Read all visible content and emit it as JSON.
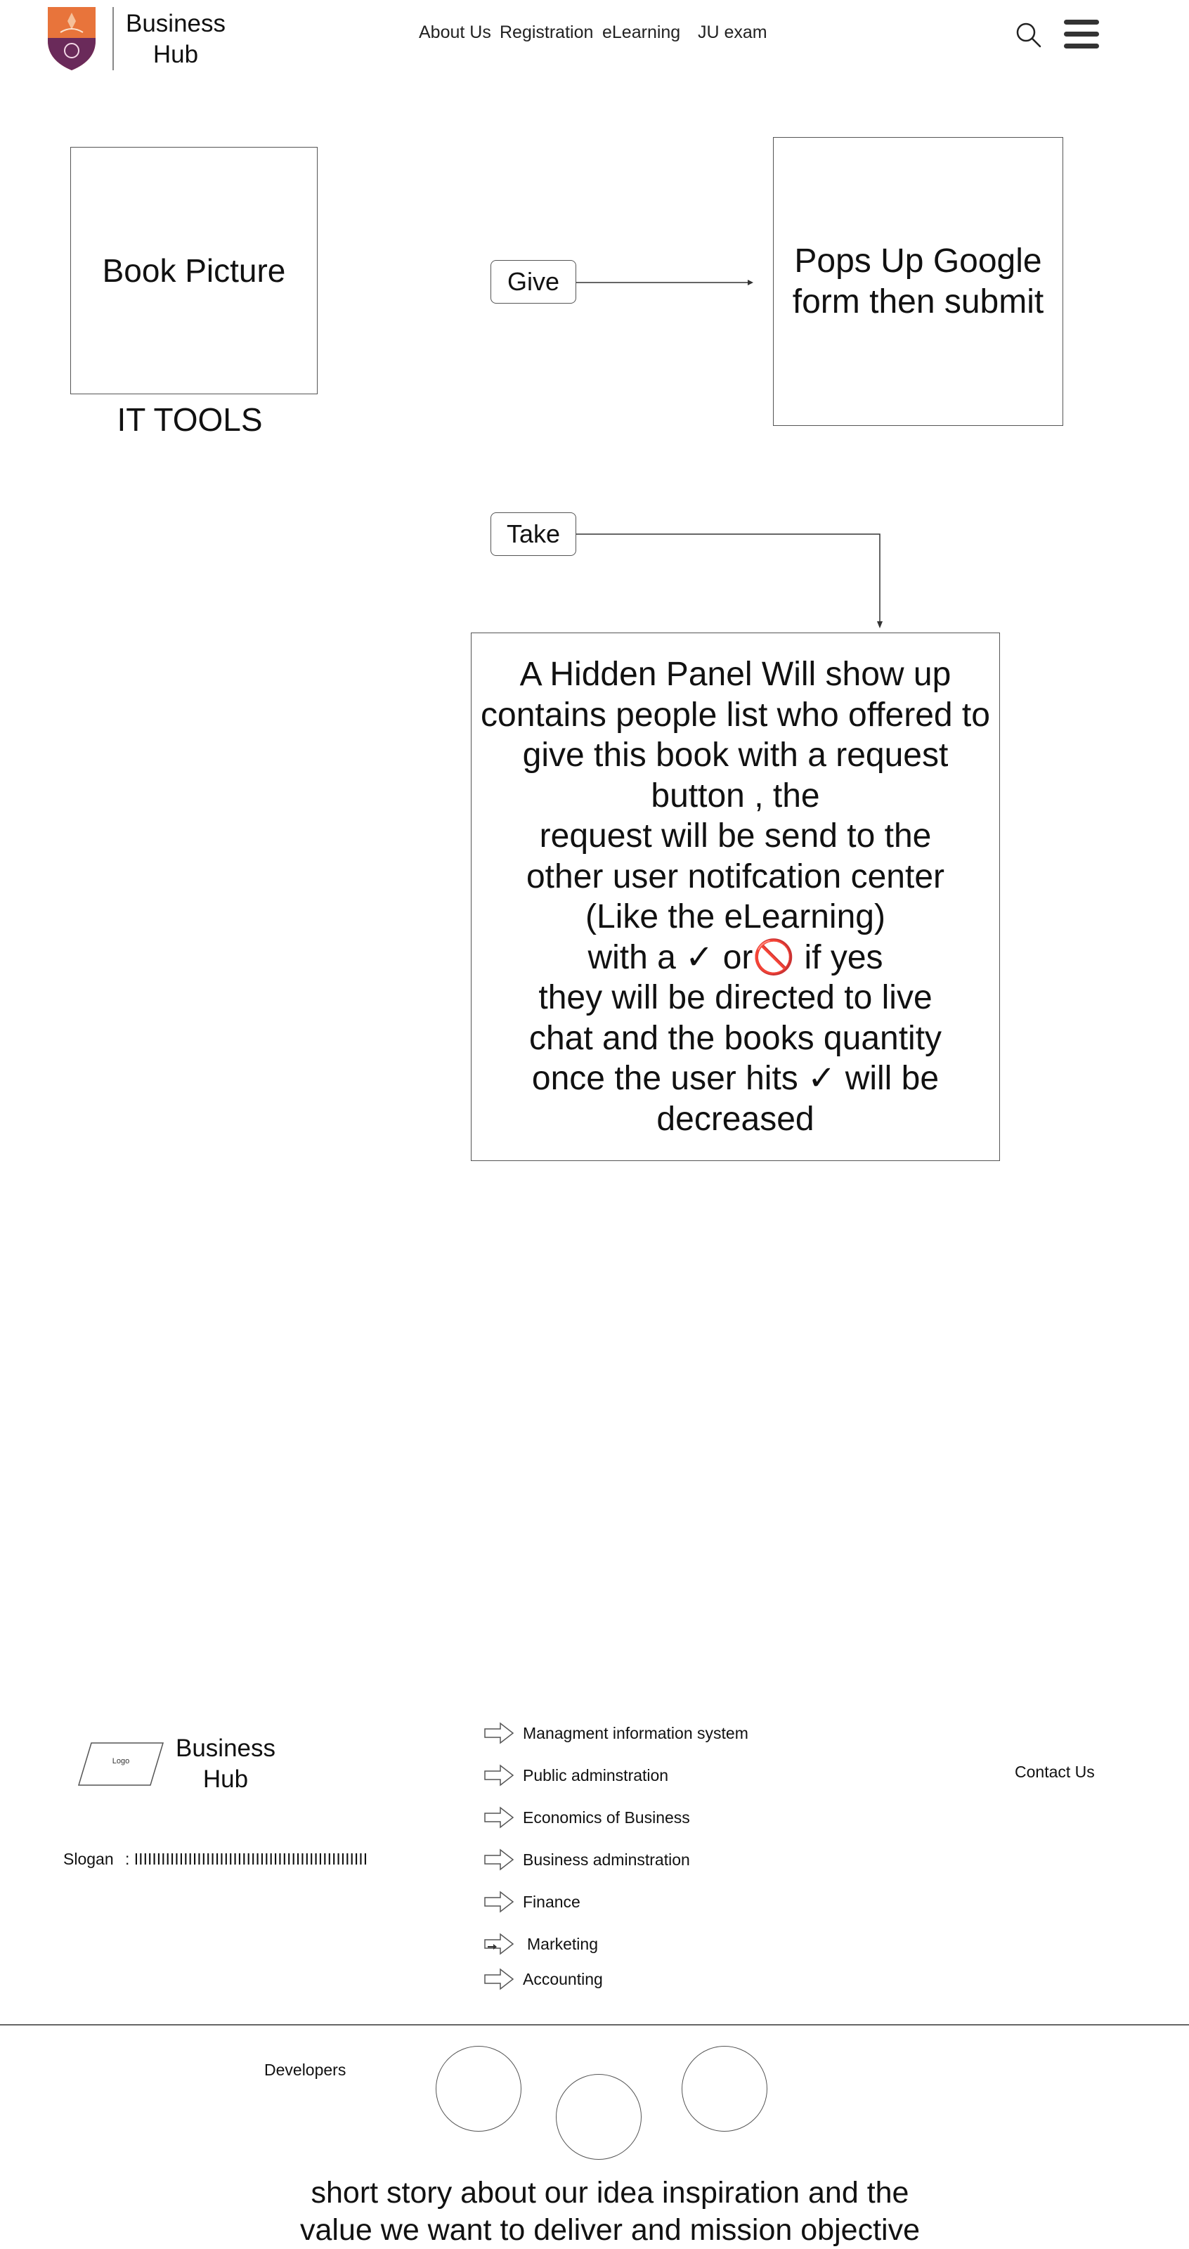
{
  "header": {
    "brand_line1": "Business",
    "brand_line2": "Hub",
    "nav": [
      "About Us",
      "Registration",
      "eLearning",
      "JU exam"
    ],
    "icons": {
      "search": "search-icon",
      "menu": "hamburger-menu-icon",
      "logo": "university-crest-logo"
    }
  },
  "main": {
    "book_picture_label": "Book Picture",
    "category_title": "IT TOOLS",
    "give_label": "Give",
    "take_label": "Take",
    "give_result_text": "Pops Up Google form then submit",
    "take_panel_lines": [
      "A Hidden Panel Will show up",
      "contains people list who offered to",
      "give this book with a request",
      "button , the",
      "request will be send to the",
      "other user notifcation center",
      "(Like the eLearning)",
      "with a ✓ or🚫 if yes",
      "they will be directed to live",
      "chat and the books quantity",
      "once the user hits ✓ will be",
      "decreased"
    ]
  },
  "footer": {
    "logo_text": "Logo",
    "brand_line1": "Business",
    "brand_line2": "Hub",
    "slogan_label": "Slogan",
    "slogan_value": ":  IIIIIIIIIIIIIIIIIIIIIIIIIIIIIIIIIIIIIIIIIIIIIIIIIIII",
    "contact_label": "Contact Us",
    "categories": [
      "Managment information system",
      "Public adminstration",
      "Economics of Business",
      "Business adminstration",
      "Finance",
      "Marketing",
      "Accounting"
    ],
    "developers_label": "Developers",
    "story_line1": "short story about our idea inspiration and the",
    "story_line2": "value we want to deliver and mission objective"
  },
  "colors": {
    "crest_orange": "#e8743b",
    "crest_purple": "#6a2a5a",
    "border": "#555555"
  }
}
